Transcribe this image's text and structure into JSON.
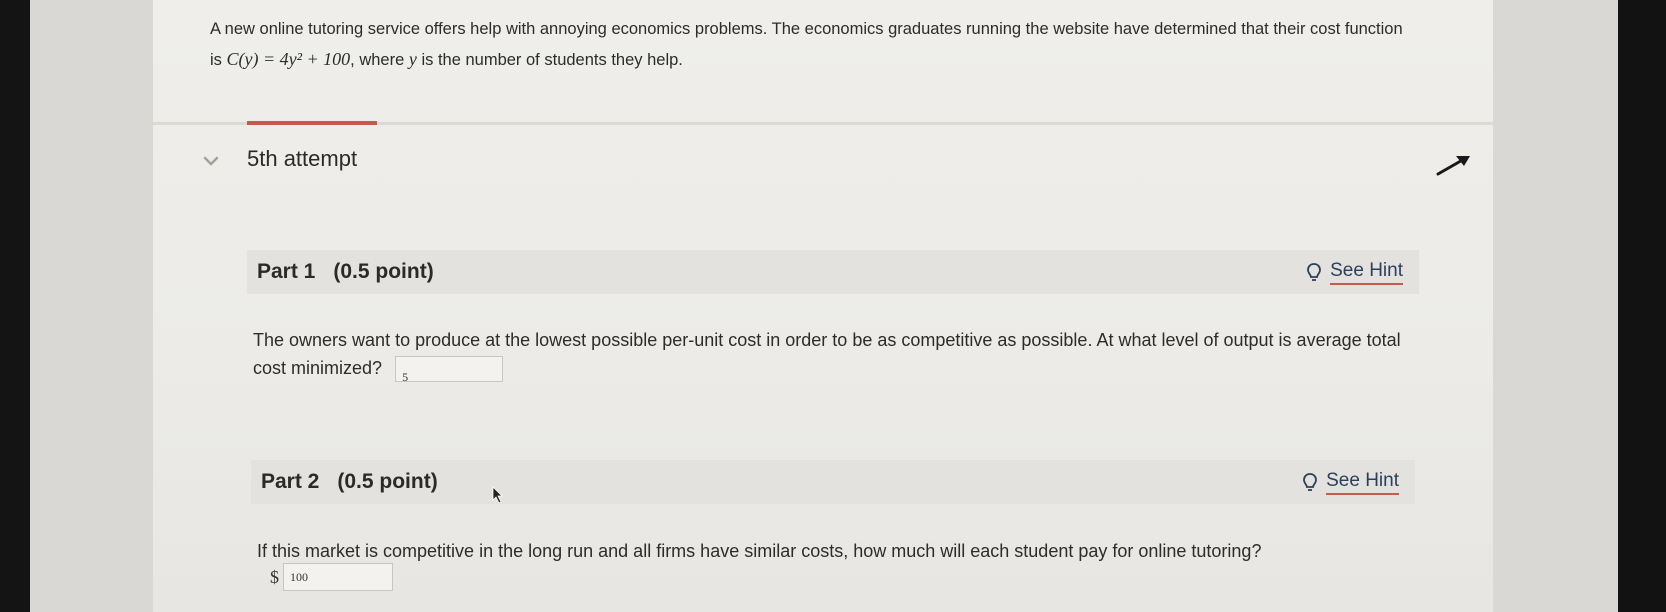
{
  "problem": {
    "text_before": "A new online tutoring service offers help with annoying economics problems. The economics graduates running the website have determined that their cost function is ",
    "formula": "C(y) = 4y² + 100",
    "text_mid": ", where ",
    "var": "y",
    "text_after": " is the number of students they help."
  },
  "attempt": {
    "label": "5th attempt"
  },
  "parts": [
    {
      "title": "Part 1",
      "points": "(0.5 point)",
      "hint_label": "See Hint",
      "question": "The owners want to produce at the lowest possible per-unit cost in order to be as competitive as possible. At what level of output is average total cost minimized?",
      "answer": "5"
    },
    {
      "title": "Part 2",
      "points": "(0.5 point)",
      "hint_label": "See Hint",
      "question": "If this market is competitive in the long run and all firms have similar costs, how much will each student pay for online tutoring?",
      "currency": "$",
      "answer": "100"
    }
  ],
  "colors": {
    "accent": "#c9594a",
    "link": "#2c3f5a"
  }
}
